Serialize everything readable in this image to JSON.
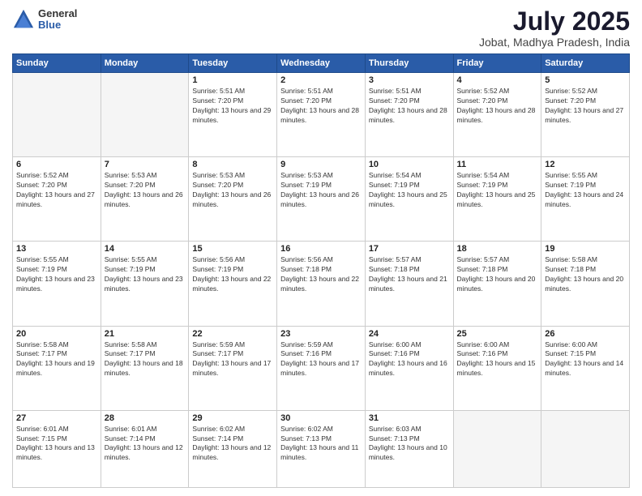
{
  "logo": {
    "general": "General",
    "blue": "Blue"
  },
  "header": {
    "month": "July 2025",
    "location": "Jobat, Madhya Pradesh, India"
  },
  "weekdays": [
    "Sunday",
    "Monday",
    "Tuesday",
    "Wednesday",
    "Thursday",
    "Friday",
    "Saturday"
  ],
  "weeks": [
    [
      {
        "day": "",
        "sunrise": "",
        "sunset": "",
        "daylight": ""
      },
      {
        "day": "",
        "sunrise": "",
        "sunset": "",
        "daylight": ""
      },
      {
        "day": "1",
        "sunrise": "Sunrise: 5:51 AM",
        "sunset": "Sunset: 7:20 PM",
        "daylight": "Daylight: 13 hours and 29 minutes."
      },
      {
        "day": "2",
        "sunrise": "Sunrise: 5:51 AM",
        "sunset": "Sunset: 7:20 PM",
        "daylight": "Daylight: 13 hours and 28 minutes."
      },
      {
        "day": "3",
        "sunrise": "Sunrise: 5:51 AM",
        "sunset": "Sunset: 7:20 PM",
        "daylight": "Daylight: 13 hours and 28 minutes."
      },
      {
        "day": "4",
        "sunrise": "Sunrise: 5:52 AM",
        "sunset": "Sunset: 7:20 PM",
        "daylight": "Daylight: 13 hours and 28 minutes."
      },
      {
        "day": "5",
        "sunrise": "Sunrise: 5:52 AM",
        "sunset": "Sunset: 7:20 PM",
        "daylight": "Daylight: 13 hours and 27 minutes."
      }
    ],
    [
      {
        "day": "6",
        "sunrise": "Sunrise: 5:52 AM",
        "sunset": "Sunset: 7:20 PM",
        "daylight": "Daylight: 13 hours and 27 minutes."
      },
      {
        "day": "7",
        "sunrise": "Sunrise: 5:53 AM",
        "sunset": "Sunset: 7:20 PM",
        "daylight": "Daylight: 13 hours and 26 minutes."
      },
      {
        "day": "8",
        "sunrise": "Sunrise: 5:53 AM",
        "sunset": "Sunset: 7:20 PM",
        "daylight": "Daylight: 13 hours and 26 minutes."
      },
      {
        "day": "9",
        "sunrise": "Sunrise: 5:53 AM",
        "sunset": "Sunset: 7:19 PM",
        "daylight": "Daylight: 13 hours and 26 minutes."
      },
      {
        "day": "10",
        "sunrise": "Sunrise: 5:54 AM",
        "sunset": "Sunset: 7:19 PM",
        "daylight": "Daylight: 13 hours and 25 minutes."
      },
      {
        "day": "11",
        "sunrise": "Sunrise: 5:54 AM",
        "sunset": "Sunset: 7:19 PM",
        "daylight": "Daylight: 13 hours and 25 minutes."
      },
      {
        "day": "12",
        "sunrise": "Sunrise: 5:55 AM",
        "sunset": "Sunset: 7:19 PM",
        "daylight": "Daylight: 13 hours and 24 minutes."
      }
    ],
    [
      {
        "day": "13",
        "sunrise": "Sunrise: 5:55 AM",
        "sunset": "Sunset: 7:19 PM",
        "daylight": "Daylight: 13 hours and 23 minutes."
      },
      {
        "day": "14",
        "sunrise": "Sunrise: 5:55 AM",
        "sunset": "Sunset: 7:19 PM",
        "daylight": "Daylight: 13 hours and 23 minutes."
      },
      {
        "day": "15",
        "sunrise": "Sunrise: 5:56 AM",
        "sunset": "Sunset: 7:19 PM",
        "daylight": "Daylight: 13 hours and 22 minutes."
      },
      {
        "day": "16",
        "sunrise": "Sunrise: 5:56 AM",
        "sunset": "Sunset: 7:18 PM",
        "daylight": "Daylight: 13 hours and 22 minutes."
      },
      {
        "day": "17",
        "sunrise": "Sunrise: 5:57 AM",
        "sunset": "Sunset: 7:18 PM",
        "daylight": "Daylight: 13 hours and 21 minutes."
      },
      {
        "day": "18",
        "sunrise": "Sunrise: 5:57 AM",
        "sunset": "Sunset: 7:18 PM",
        "daylight": "Daylight: 13 hours and 20 minutes."
      },
      {
        "day": "19",
        "sunrise": "Sunrise: 5:58 AM",
        "sunset": "Sunset: 7:18 PM",
        "daylight": "Daylight: 13 hours and 20 minutes."
      }
    ],
    [
      {
        "day": "20",
        "sunrise": "Sunrise: 5:58 AM",
        "sunset": "Sunset: 7:17 PM",
        "daylight": "Daylight: 13 hours and 19 minutes."
      },
      {
        "day": "21",
        "sunrise": "Sunrise: 5:58 AM",
        "sunset": "Sunset: 7:17 PM",
        "daylight": "Daylight: 13 hours and 18 minutes."
      },
      {
        "day": "22",
        "sunrise": "Sunrise: 5:59 AM",
        "sunset": "Sunset: 7:17 PM",
        "daylight": "Daylight: 13 hours and 17 minutes."
      },
      {
        "day": "23",
        "sunrise": "Sunrise: 5:59 AM",
        "sunset": "Sunset: 7:16 PM",
        "daylight": "Daylight: 13 hours and 17 minutes."
      },
      {
        "day": "24",
        "sunrise": "Sunrise: 6:00 AM",
        "sunset": "Sunset: 7:16 PM",
        "daylight": "Daylight: 13 hours and 16 minutes."
      },
      {
        "day": "25",
        "sunrise": "Sunrise: 6:00 AM",
        "sunset": "Sunset: 7:16 PM",
        "daylight": "Daylight: 13 hours and 15 minutes."
      },
      {
        "day": "26",
        "sunrise": "Sunrise: 6:00 AM",
        "sunset": "Sunset: 7:15 PM",
        "daylight": "Daylight: 13 hours and 14 minutes."
      }
    ],
    [
      {
        "day": "27",
        "sunrise": "Sunrise: 6:01 AM",
        "sunset": "Sunset: 7:15 PM",
        "daylight": "Daylight: 13 hours and 13 minutes."
      },
      {
        "day": "28",
        "sunrise": "Sunrise: 6:01 AM",
        "sunset": "Sunset: 7:14 PM",
        "daylight": "Daylight: 13 hours and 12 minutes."
      },
      {
        "day": "29",
        "sunrise": "Sunrise: 6:02 AM",
        "sunset": "Sunset: 7:14 PM",
        "daylight": "Daylight: 13 hours and 12 minutes."
      },
      {
        "day": "30",
        "sunrise": "Sunrise: 6:02 AM",
        "sunset": "Sunset: 7:13 PM",
        "daylight": "Daylight: 13 hours and 11 minutes."
      },
      {
        "day": "31",
        "sunrise": "Sunrise: 6:03 AM",
        "sunset": "Sunset: 7:13 PM",
        "daylight": "Daylight: 13 hours and 10 minutes."
      },
      {
        "day": "",
        "sunrise": "",
        "sunset": "",
        "daylight": ""
      },
      {
        "day": "",
        "sunrise": "",
        "sunset": "",
        "daylight": ""
      }
    ]
  ]
}
